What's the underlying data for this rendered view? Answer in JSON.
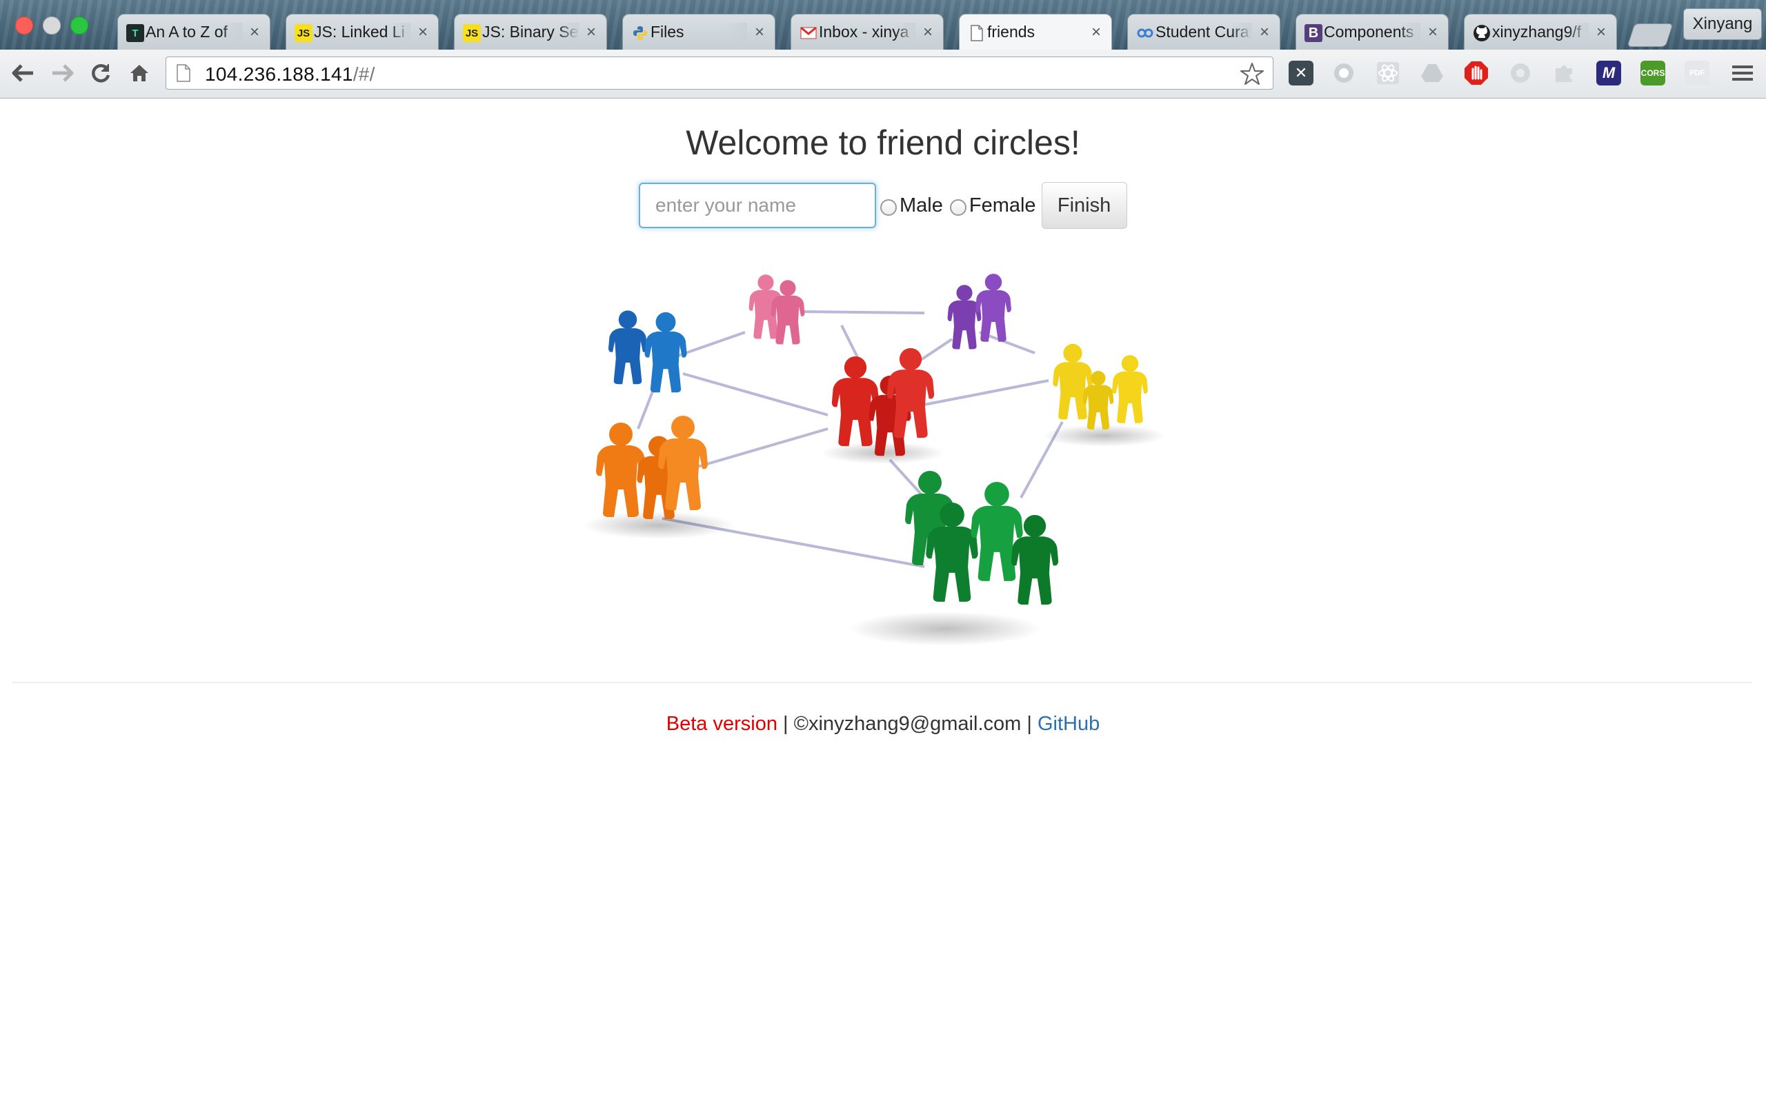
{
  "browser": {
    "tabs": [
      {
        "title": "An A to Z of",
        "icon": "terminal-favicon"
      },
      {
        "title": "JS: Linked Li",
        "icon": "js-favicon"
      },
      {
        "title": "JS: Binary Se",
        "icon": "js-favicon"
      },
      {
        "title": "Files",
        "icon": "python-favicon"
      },
      {
        "title": "Inbox - xinya",
        "icon": "gmail-favicon"
      },
      {
        "title": "friends",
        "icon": "page-favicon",
        "active": true
      },
      {
        "title": "Student Cura",
        "icon": "link-favicon"
      },
      {
        "title": "Components",
        "icon": "bootstrap-favicon"
      },
      {
        "title": "xinyzhang9/f",
        "icon": "github-favicon"
      }
    ],
    "close_glyph": "×",
    "profile_name": "Xinyang",
    "url_host": "104.236.188.141",
    "url_path": "/#/",
    "extensions": [
      "x-extension-icon",
      "circle-extension-icon",
      "react-extension-icon",
      "drive-extension-icon",
      "stop-extension-icon",
      "grey-circle-extension-icon",
      "grey-puzzle-extension-icon",
      "m-extension-icon",
      "cors-extension-icon",
      "pdf-extension-icon"
    ],
    "cors_label": "CORS",
    "m_label": "M",
    "pdf_label": "PDF",
    "bootstrap_letter": "B",
    "js_letters": "JS"
  },
  "page": {
    "title": "Welcome to friend circles!",
    "name_placeholder": "enter your name",
    "gender_options": [
      "Male",
      "Female"
    ],
    "finish_label": "Finish"
  },
  "footer": {
    "beta": "Beta version",
    "sep1": " | ",
    "copyright": "©xinyzhang9@gmail.com",
    "sep2": " | ",
    "github": "GitHub"
  },
  "colors": {
    "beta": "#e00000",
    "link": "#2a6fb5",
    "input_focus": "#66afe9"
  }
}
